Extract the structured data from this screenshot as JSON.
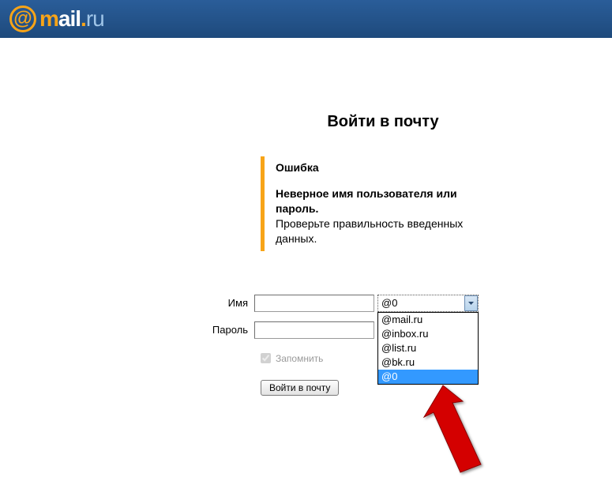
{
  "logo": {
    "at": "@",
    "brand_m": "m",
    "brand_ail": "ail",
    "brand_dot": ".",
    "brand_ru": "ru"
  },
  "page_title": "Войти в почту",
  "error": {
    "title": "Ошибка",
    "bold_msg": "Неверное имя пользователя или пароль.",
    "plain_msg": "Проверьте правильность введенных данных."
  },
  "form": {
    "name_label": "Имя",
    "name_value": "",
    "pass_label": "Пароль",
    "pass_value": "",
    "domain_selected": "@0",
    "domain_options": [
      "@mail.ru",
      "@inbox.ru",
      "@list.ru",
      "@bk.ru",
      "@0"
    ],
    "remember_label": "Запомнить",
    "remember_checked": true,
    "submit_label": "Войти в почту"
  },
  "colors": {
    "accent_orange": "#f7a418",
    "header_blue": "#1e4a7c",
    "highlight_blue": "#3399ff",
    "arrow_red": "#d40000"
  }
}
